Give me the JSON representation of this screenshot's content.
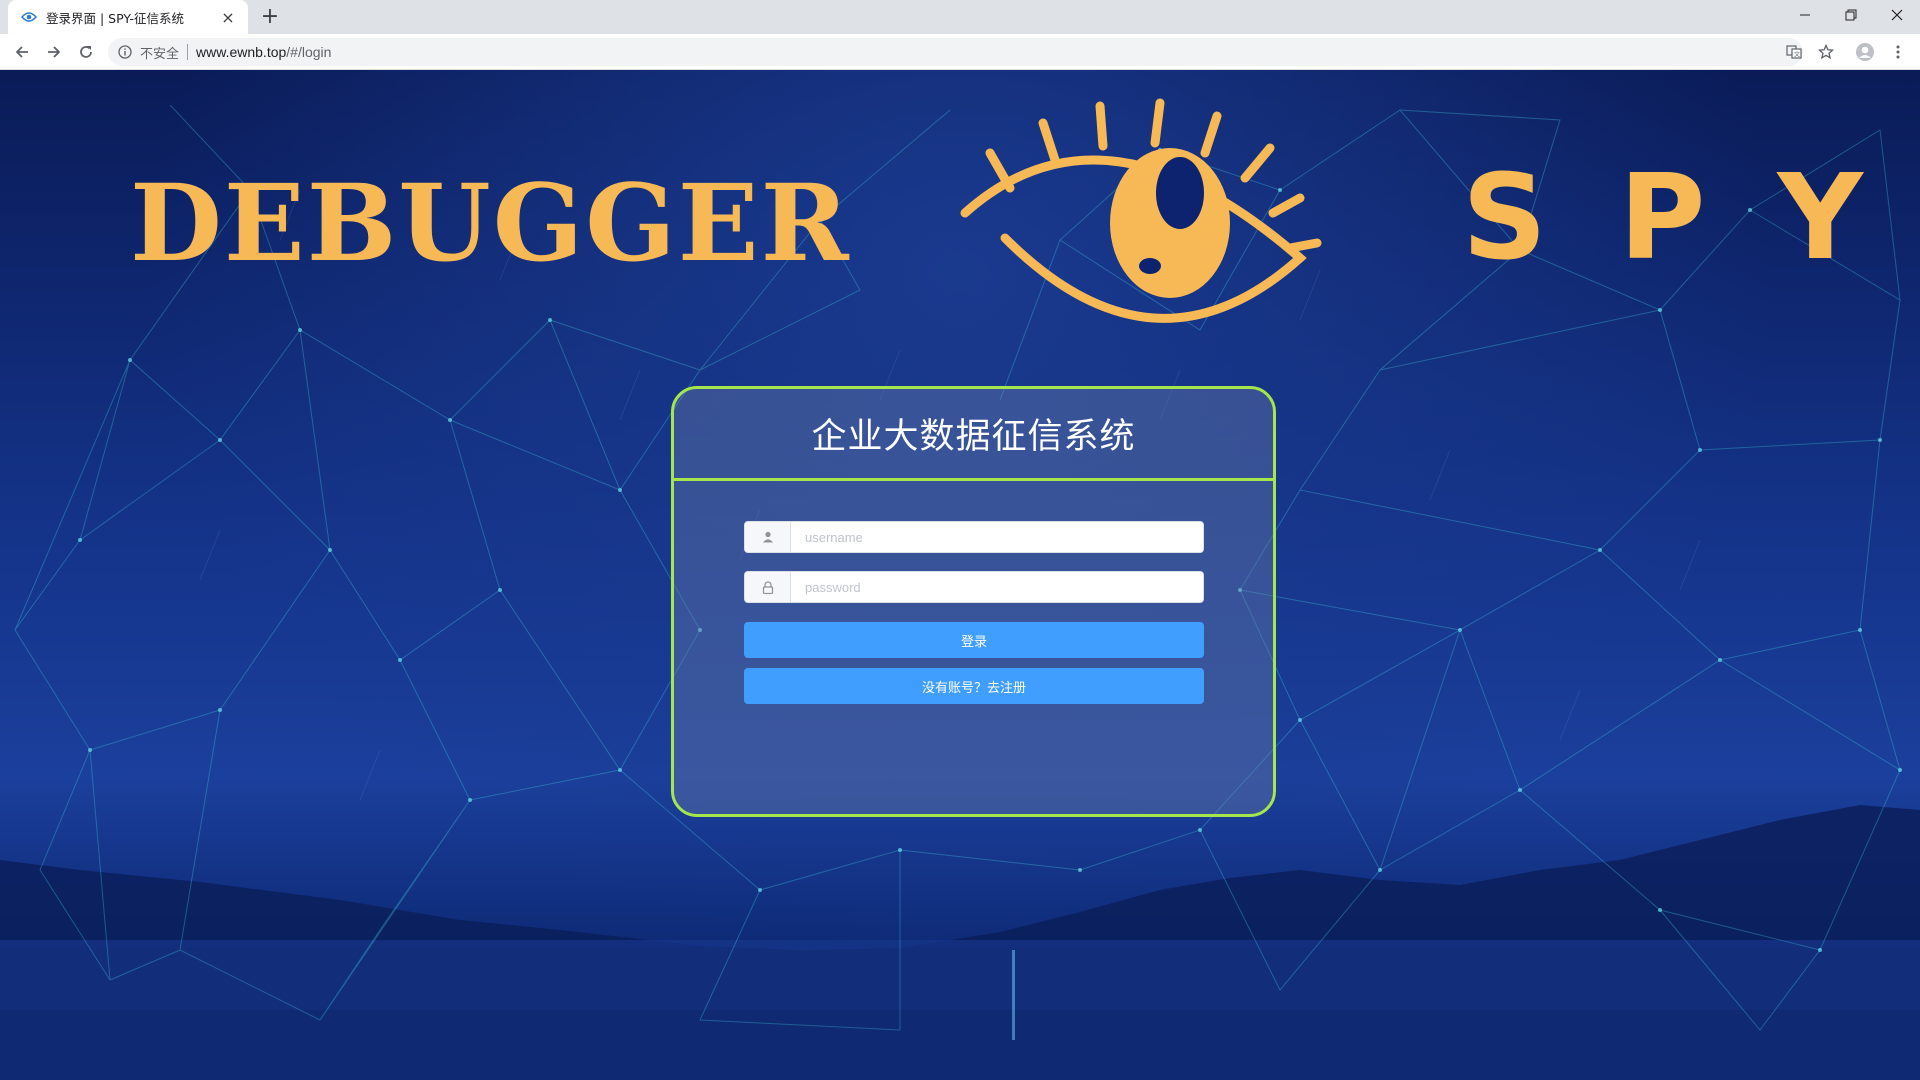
{
  "browser": {
    "tab_title": "登录界面 | SPY-征信系统",
    "tab_close": "×",
    "new_tab": "+",
    "security_label": "不安全",
    "url_host": "www.ewnb.top",
    "url_path": "/#/login"
  },
  "branding": {
    "left_logo_text": "DEBUGGER",
    "right_logo_text": "SPY",
    "accent_color": "#f7b955"
  },
  "login": {
    "title": "企业大数据征信系统",
    "username_placeholder": "username",
    "password_placeholder": "password",
    "login_button": "登录",
    "register_button": "没有账号？去注册",
    "border_color": "#a4e64b",
    "button_color": "#409eff"
  }
}
